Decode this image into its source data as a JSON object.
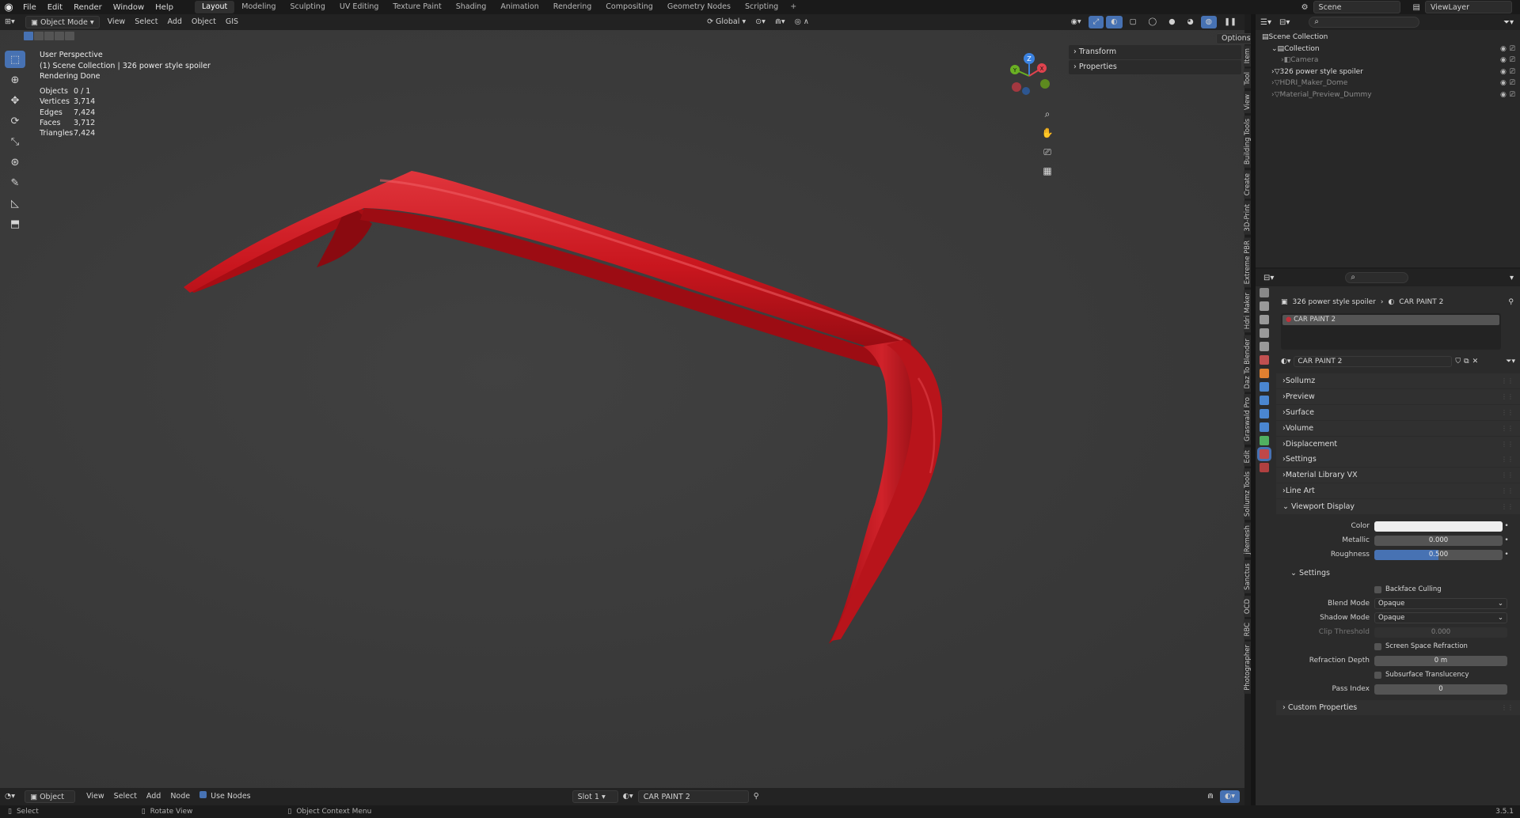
{
  "topbar": {
    "menus": [
      "File",
      "Edit",
      "Render",
      "Window",
      "Help"
    ],
    "workspaces": [
      "Layout",
      "Modeling",
      "Sculpting",
      "UV Editing",
      "Texture Paint",
      "Shading",
      "Animation",
      "Rendering",
      "Compositing",
      "Geometry Nodes",
      "Scripting"
    ],
    "active_workspace": "Layout",
    "add_tab": "+",
    "scene": "Scene",
    "view_layer": "ViewLayer"
  },
  "viewport_header": {
    "mode": "Object Mode",
    "menus": [
      "View",
      "Select",
      "Add",
      "Object",
      "GIS"
    ],
    "orientation": "Global",
    "options": "Options"
  },
  "viewport_info": {
    "perspective": "User Perspective",
    "collection_line": "(1) Scene Collection | 326 power style spoiler",
    "render_status": "Rendering Done",
    "stats": [
      {
        "label": "Objects",
        "value": "0 / 1"
      },
      {
        "label": "Vertices",
        "value": "3,714"
      },
      {
        "label": "Edges",
        "value": "7,424"
      },
      {
        "label": "Faces",
        "value": "3,712"
      },
      {
        "label": "Triangles",
        "value": "7,424"
      }
    ]
  },
  "npanel": {
    "sections": [
      "Transform",
      "Properties"
    ],
    "tabs": [
      "Item",
      "Tool",
      "View",
      "Building Tools",
      "Create",
      "3D-Print",
      "Extreme PBR",
      "Hdri Maker",
      "Daz To Blender",
      "Graswald Pro",
      "Edit",
      "Sollumz Tools",
      "jRemesh",
      "Sanctus",
      "OCD",
      "RBC",
      "Photographer"
    ]
  },
  "outliner": {
    "root": "Scene Collection",
    "items": [
      {
        "name": "Collection",
        "level": 1,
        "dim": false
      },
      {
        "name": "Camera",
        "level": 2,
        "dim": true
      },
      {
        "name": "326 power style spoiler",
        "level": 1,
        "dim": false
      },
      {
        "name": "HDRI_Maker_Dome",
        "level": 1,
        "dim": true
      },
      {
        "name": "Material_Preview_Dummy",
        "level": 1,
        "dim": true
      }
    ]
  },
  "properties": {
    "breadcrumb_object": "326 power style spoiler",
    "breadcrumb_material": "CAR PAINT 2",
    "slot_material": "CAR PAINT 2",
    "material_name": "CAR PAINT 2",
    "panels": [
      "Sollumz",
      "Preview",
      "Surface",
      "Volume",
      "Displacement",
      "Settings",
      "Material Library VX",
      "Line Art"
    ],
    "viewport_display": {
      "title": "Viewport Display",
      "color_label": "Color",
      "metallic_label": "Metallic",
      "metallic": "0.000",
      "roughness_label": "Roughness",
      "roughness": "0.500",
      "roughness_fraction": 0.5
    },
    "settings": {
      "title": "Settings",
      "backface_culling": "Backface Culling",
      "blend_mode_label": "Blend Mode",
      "blend_mode": "Opaque",
      "shadow_mode_label": "Shadow Mode",
      "shadow_mode": "Opaque",
      "clip_threshold_label": "Clip Threshold",
      "clip_threshold": "0.000",
      "ssr": "Screen Space Refraction",
      "refraction_depth_label": "Refraction Depth",
      "refraction_depth": "0 m",
      "subsurface": "Subsurface Translucency",
      "pass_index_label": "Pass Index",
      "pass_index": "0"
    },
    "custom_properties": "Custom Properties"
  },
  "shader_header": {
    "mode": "Object",
    "menus": [
      "View",
      "Select",
      "Add",
      "Node"
    ],
    "use_nodes": "Use Nodes",
    "slot": "Slot 1",
    "material": "CAR PAINT 2"
  },
  "status_bar": {
    "select": "Select",
    "rotate": "Rotate View",
    "context": "Object Context Menu",
    "version": "3.5.1"
  },
  "colors": {
    "accent": "#4772b3",
    "spoiler": "#c8141c",
    "selected_row": "#334d80"
  }
}
